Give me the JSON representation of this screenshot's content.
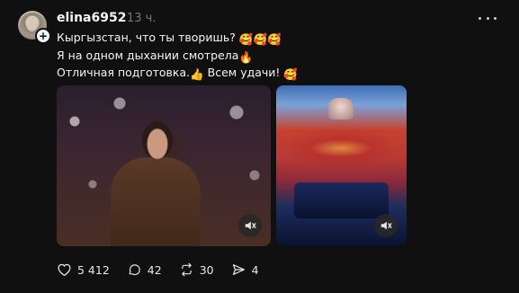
{
  "post": {
    "username": "elina6952",
    "time": "13 ч.",
    "lines": [
      "Кыргызстан, что ты творишь?",
      "Я на одном дыхании смотрела",
      "Отличная подготовка.",
      "Всем удачи!"
    ],
    "emojis": {
      "line1": "🥰🥰🥰",
      "line2": "🔥",
      "line3a": "👍",
      "line3b": "🥰"
    }
  },
  "actions": {
    "likes": "5 412",
    "replies": "42",
    "reposts": "30",
    "shares": "4"
  },
  "icons": {
    "follow": "plus-icon",
    "more": "more-icon",
    "mute": "speaker-muted-icon",
    "like": "heart-icon",
    "reply": "comment-icon",
    "repost": "repost-icon",
    "share": "send-icon"
  },
  "colors": {
    "background": "#101010",
    "text": "#f3f5f7",
    "muted": "#777777"
  }
}
